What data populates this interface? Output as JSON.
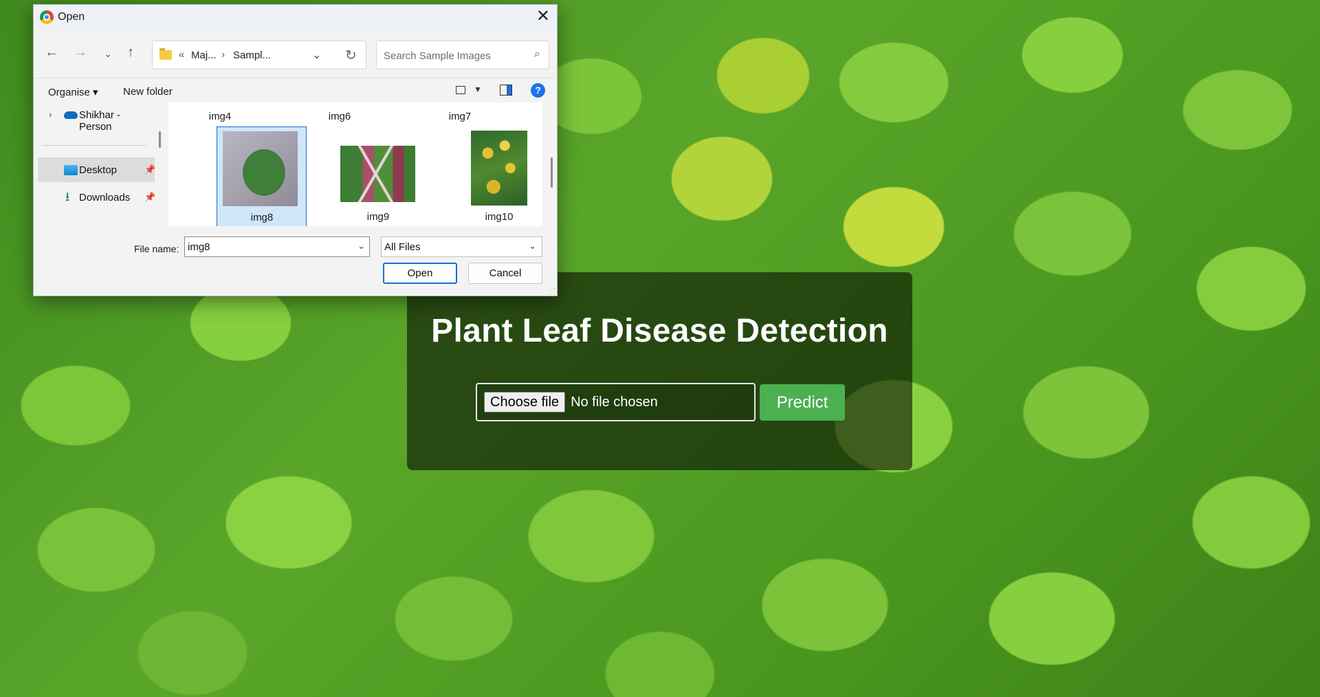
{
  "app": {
    "title": "Plant Leaf Disease Detection",
    "choose_file_label": "Choose file",
    "file_status": "No file chosen",
    "predict_label": "Predict",
    "colors": {
      "predict": "#4caf50",
      "card_overlay": "rgba(0,0,0,0.55)"
    }
  },
  "dialog": {
    "title": "Open",
    "address": {
      "segment_1": "Maj...",
      "segment_2": "Sampl...",
      "overflow": "«",
      "separator": "›"
    },
    "search_placeholder": "Search Sample Images",
    "commands": {
      "organise": "Organise ▾",
      "new_folder": "New folder",
      "help": "?"
    },
    "nav": [
      {
        "label": "Shikhar - Person",
        "icon": "onedrive-cloud-icon"
      },
      {
        "label": "Desktop",
        "icon": "desktop-icon"
      },
      {
        "label": "Downloads",
        "icon": "download-icon"
      }
    ],
    "files_top_row": [
      "img4",
      "img6",
      "img7"
    ],
    "files": [
      {
        "name": "img8",
        "selected": true
      },
      {
        "name": "img9",
        "selected": false
      },
      {
        "name": "img10",
        "selected": false
      }
    ],
    "file_name_label": "File name:",
    "file_name_value": "img8",
    "file_type_value": "All Files",
    "open_label": "Open",
    "cancel_label": "Cancel"
  }
}
